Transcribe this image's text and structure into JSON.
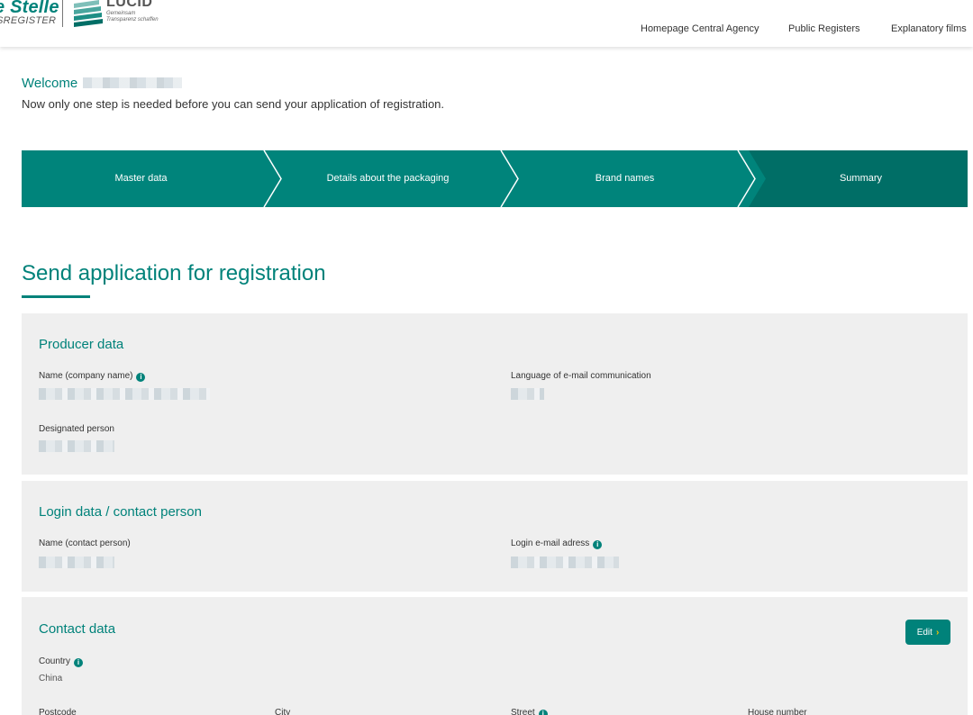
{
  "header": {
    "brand_title": "e Stelle",
    "brand_sub": "SREGISTER",
    "lucid_title": "LUCID",
    "lucid_sub1": "Gemeinsam",
    "lucid_sub2": "Transparenz schaffen",
    "nav": [
      {
        "label": "Homepage Central Agency"
      },
      {
        "label": "Public Registers"
      },
      {
        "label": "Explanatory films"
      }
    ]
  },
  "welcome": {
    "greeting": "Welcome",
    "message": "Now only one step is needed before you can send your application of registration."
  },
  "stepper": {
    "steps": [
      {
        "label": "Master data"
      },
      {
        "label": "Details about the packaging"
      },
      {
        "label": "Brand names"
      },
      {
        "label": "Summary"
      }
    ],
    "active_index": 3,
    "colors": {
      "step": "#00847b",
      "active": "#006e66",
      "separator": "#ffffff"
    }
  },
  "page": {
    "title": "Send application for registration"
  },
  "sections": {
    "producer": {
      "title": "Producer data",
      "company_name_label": "Name (company name)",
      "language_label": "Language of e-mail communication",
      "designated_person_label": "Designated person"
    },
    "login": {
      "title": "Login data / contact person",
      "contact_name_label": "Name (contact person)",
      "login_email_label": "Login e-mail adress"
    },
    "contact": {
      "title": "Contact data",
      "edit_label": "Edit",
      "country_label": "Country",
      "country_value": "China",
      "postcode_label": "Postcode",
      "city_label": "City",
      "street_label": "Street",
      "house_number_label": "House number"
    }
  },
  "icons": {
    "info": "info-icon",
    "chevron": "chevron-right-icon"
  },
  "colors": {
    "brand": "#00827a",
    "panel": "#efefef",
    "accent": "#f5c400"
  }
}
